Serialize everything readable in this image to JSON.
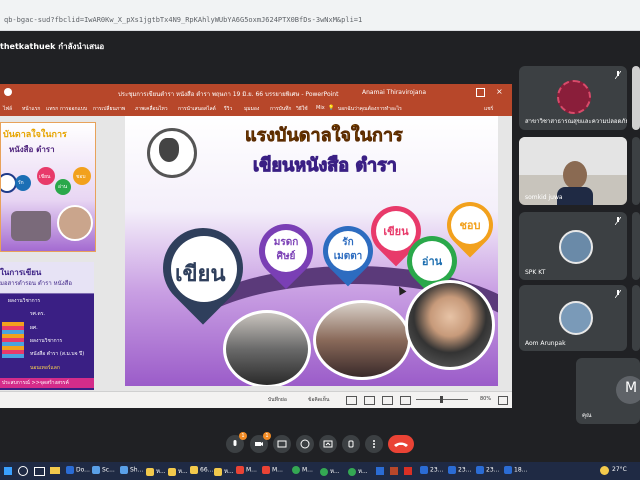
{
  "browser": {
    "url": "qb-bgac-sud?fbclid=IwAR0Kw_X_pXs1jgtbTx4N9_RpKAhlyWUbYA6G5oxmJ624PTX0BfDs-3wNxM&pli=1"
  },
  "meeting": {
    "presenter_label": "thetkathuek กำลังนำเสนอ"
  },
  "powerpoint": {
    "title": "ประชุมการเขียนตำรา หนังสือ ตำรา  พฤษภา 19 มิ.ย. 66 บรรยายพิเศษ - PowerPoint",
    "user": "Anamai Thiravirojana",
    "menu": [
      "ไฟล์",
      "หน้าแรก",
      "แทรก",
      "การออกแบบ",
      "การเปลี่ยนภาพ",
      "ภาพเคลื่อนไหว",
      "การนำเสนอสไลด์",
      "รีวิว",
      "มุมมอง",
      "การบันทึก",
      "วิธีใช้",
      "Mix",
      "บอกฉันว่าคุณต้องการทำอะไร",
      "แชร์"
    ],
    "status": {
      "notes": "บันทึกย่อ",
      "comments": "ข้อคิดเห็น",
      "zoom": "80%"
    }
  },
  "thumb1": {
    "title": "บันดาลใจในการ",
    "subtitle": "หนังสือ ตำรา",
    "tags": [
      "รัก",
      "มรดก",
      "เขียน",
      "อ่าน",
      "ชอบ"
    ]
  },
  "thumb2": {
    "lines": [
      "ในการเขียน",
      "มอสารตำรอน ตำรา หนังสือ",
      "ผลงานวิชาการ",
      "รศ.ดร.",
      "ผศ.",
      "ผลงานวิชาการ",
      "หนังสือ ตำรา (ส.ม.บจ ปี)",
      "นอนเทอร์แลก"
    ],
    "footer": "ประสบการณ์ >>จุดสร้างสรรค์"
  },
  "slide": {
    "title_line1": "แรงบันดาลใจในการ",
    "title_line2": "เขียนหนังสือ ตำรา",
    "big_word": "เขียน",
    "pins": [
      "มรดก ศิษย์",
      "รัก เมตตา",
      "เขียน",
      "อ่าน",
      "ชอบ"
    ]
  },
  "participants": [
    {
      "name": "สาขาวิชาสาธารณสุขและความปลอดภัย ม..."
    },
    {
      "name": "somkid juwa"
    },
    {
      "name": "SPK KT"
    },
    {
      "name": "Aom Arunpak"
    },
    {
      "name": "คุณ",
      "initial": "M"
    }
  ],
  "controls": {
    "badge1": "1",
    "badge2": "1"
  },
  "taskbar": {
    "items": [
      "Do...",
      "Sc...",
      "Sh...",
      "ห...",
      "ห...",
      "66...",
      "ห...",
      "M...",
      "M...",
      "M...",
      "ห...",
      "ห...",
      "23...",
      "23...",
      "23...",
      "18..."
    ],
    "temp": "27°C"
  },
  "colors": {
    "accent": "#b7472a",
    "hangup": "#ea4335",
    "slide_purple": "#9b5cc9"
  }
}
